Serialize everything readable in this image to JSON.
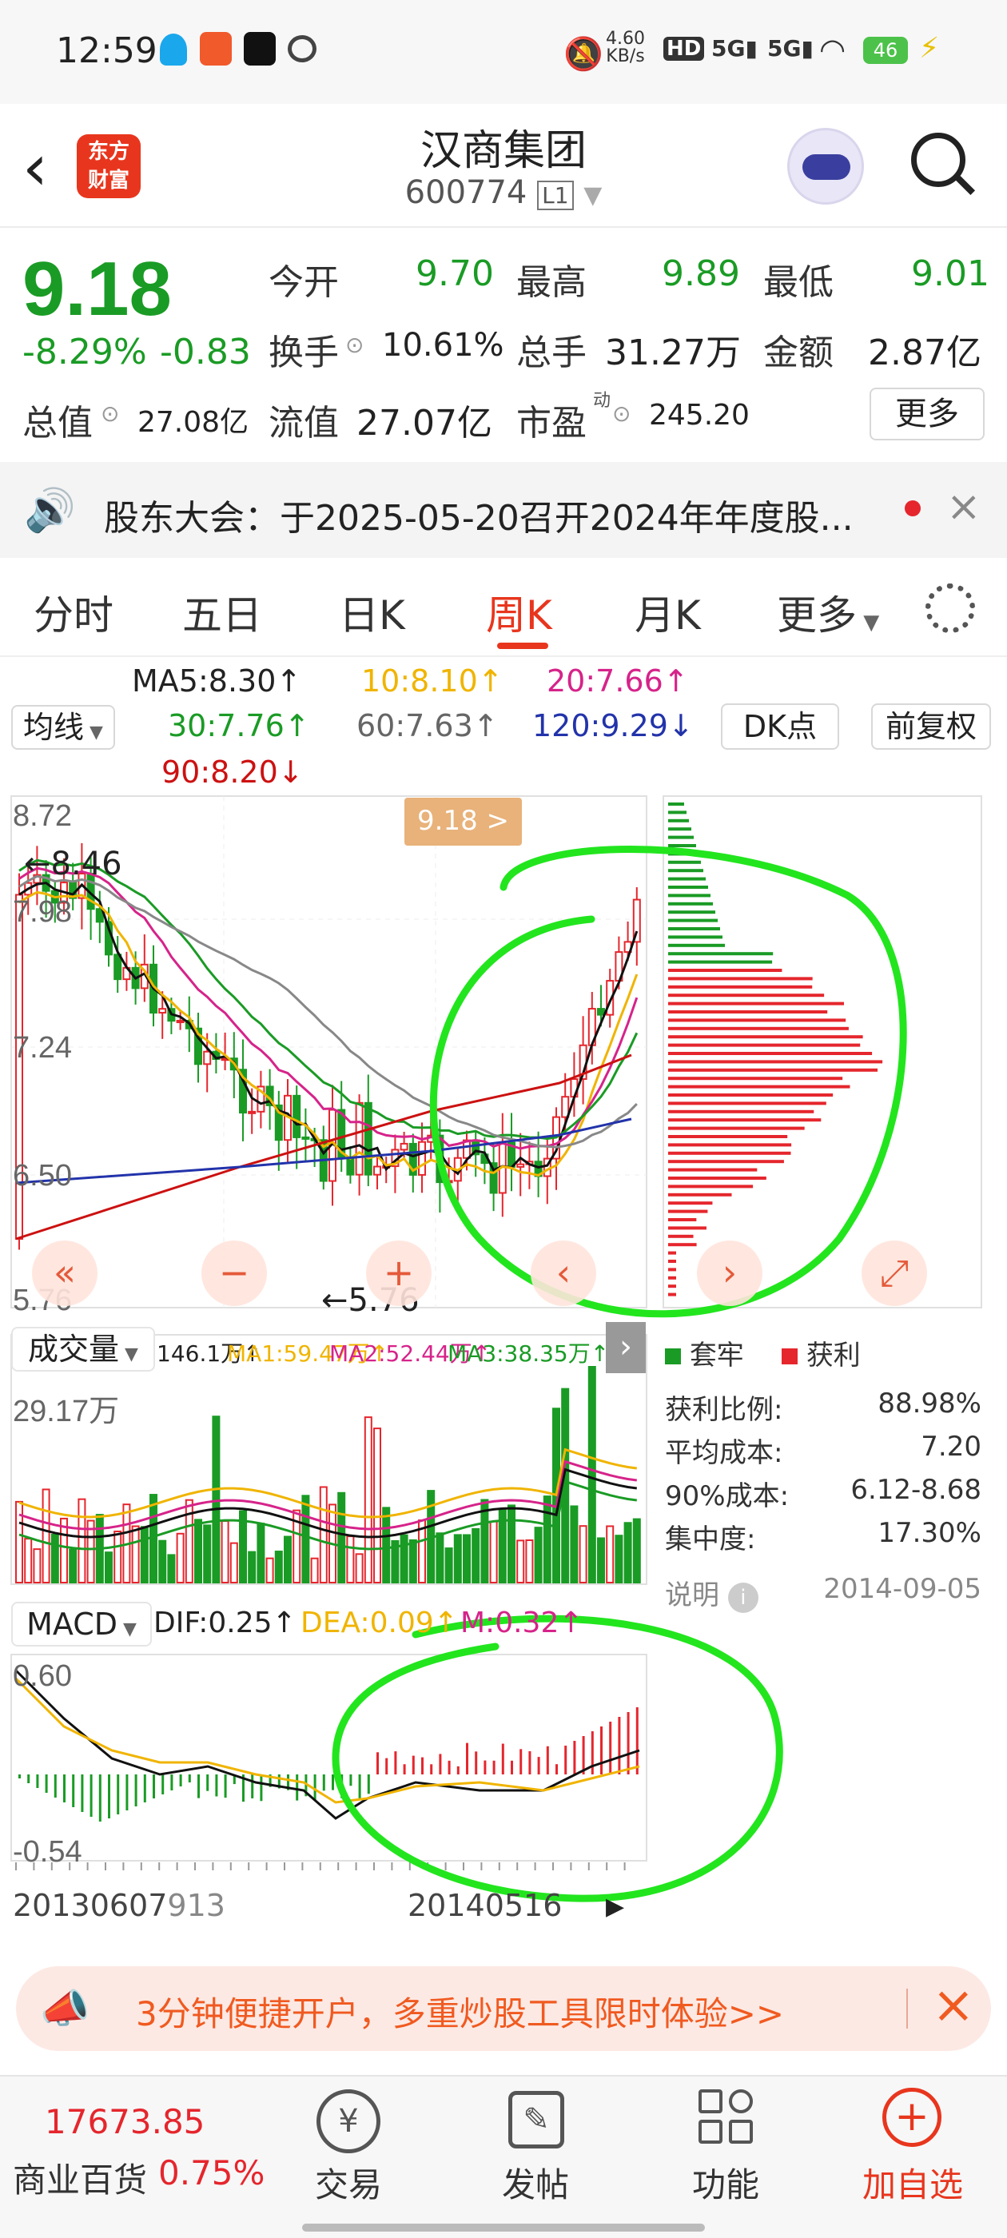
{
  "status": {
    "time": "12:59",
    "net_speed": "4.60",
    "net_unit": "KB/s",
    "battery": "46"
  },
  "header": {
    "title": "汉商集团",
    "code": "600774",
    "level": "L1",
    "logo_top": "东方",
    "logo_bottom": "财富"
  },
  "quote": {
    "price": "9.18",
    "pct": "-8.29%",
    "chg": "-0.83",
    "open_lbl": "今开",
    "open": "9.70",
    "high_lbl": "最高",
    "high": "9.89",
    "low_lbl": "最低",
    "low": "9.01",
    "turnover_lbl": "换手",
    "turnover": "10.61%",
    "volume_lbl": "总手",
    "volume": "31.27万",
    "amount_lbl": "金额",
    "amount": "2.87亿",
    "mcap_lbl": "总值",
    "mcap": "27.08亿",
    "float_lbl": "流值",
    "float": "27.07亿",
    "pe_lbl": "市盈",
    "pe_sup": "动",
    "pe": "245.20",
    "more": "更多"
  },
  "announcement": {
    "text": "股东大会：于2025-05-20召开2024年年度股..."
  },
  "tabs": [
    "分时",
    "五日",
    "日K",
    "周K",
    "月K",
    "更多"
  ],
  "active_tab": "周K",
  "ma": {
    "selector": "均线",
    "ma5": "MA5:8.30↑",
    "ma10": "10:8.10↑",
    "ma20": "20:7.66↑",
    "ma30": "30:7.76↑",
    "ma60": "60:7.63↑",
    "ma120": "120:9.29↓",
    "ma90": "90:8.20↓",
    "dk": "DK点",
    "fq": "前复权"
  },
  "kchart": {
    "y_labels": [
      "8.72",
      "7.98",
      "7.24",
      "6.50",
      "5.76"
    ],
    "hi_mark": "←8.46",
    "lo_mark": "←5.76",
    "price_tag": "9.18 >",
    "colors": {
      "ma5": "#111111",
      "ma10": "#f0b400",
      "ma20": "#d6238a",
      "ma30": "#1a9b25",
      "ma60": "#888888",
      "ma120": "#2233aa",
      "ma90": "#cc1111"
    }
  },
  "volume": {
    "selector": "成交量",
    "v": "146.1万↑",
    "ma1": "MA1:59.47万↑",
    "ma2": "MA2:52.44万↑",
    "ma3": "MA3:38.35万↑",
    "max": "29.17万"
  },
  "macd": {
    "selector": "MACD",
    "dif": "DIF:0.25↑",
    "dea": "DEA:0.09↑",
    "m": "M:0.32↑",
    "top": "0.60",
    "bottom": "-0.54"
  },
  "dates": {
    "left": "20130607",
    "mid_left": "913",
    "right": "20140516"
  },
  "chip": {
    "legend_trap": "套牢",
    "legend_profit": "获利",
    "rows": [
      {
        "k": "获利比例:",
        "v": "88.98%"
      },
      {
        "k": "平均成本:",
        "v": "7.20"
      },
      {
        "k": "90%成本:",
        "v": "6.12-8.68"
      },
      {
        "k": "集中度:",
        "v": "17.30%"
      }
    ],
    "note": "说明",
    "date": "2014-09-05"
  },
  "promo": {
    "text": "3分钟便捷开户，多重炒股工具限时体验>>"
  },
  "bottom": {
    "index_value": "17673.85",
    "index_name": "商业百货",
    "index_pct": "0.75%",
    "trade": "交易",
    "post": "发帖",
    "func": "功能",
    "add": "加自选"
  }
}
